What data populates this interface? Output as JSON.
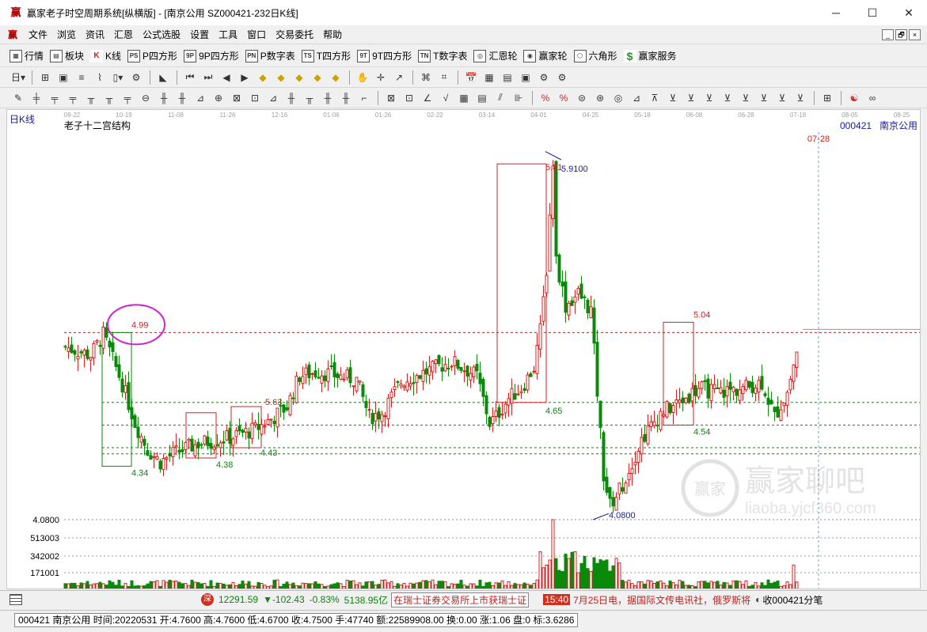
{
  "window": {
    "title": "赢家老子时空周期系统[纵横版] - [南京公用  SZ000421-232日K线]",
    "icon": "app-logo-icon",
    "minimize": "─",
    "maximize": "☐",
    "close": "✕"
  },
  "menu": {
    "items": [
      "文件",
      "浏览",
      "资讯",
      "汇恩",
      "公式选股",
      "设置",
      "工具",
      "窗口",
      "交易委托",
      "帮助"
    ],
    "mdi": [
      "_",
      "🗗",
      "×"
    ]
  },
  "toolbar1": {
    "items": [
      {
        "label": "行情",
        "icon": "table-icon",
        "glyph": "▦"
      },
      {
        "label": "板块",
        "icon": "sector-grid-icon",
        "glyph": "▤"
      },
      {
        "label": "K线",
        "icon": "candlestick-icon",
        "glyph": "K"
      },
      {
        "label": "P四方形",
        "icon": "ps-icon",
        "glyph": "PS"
      },
      {
        "label": "9P四方形",
        "icon": "9p-icon",
        "glyph": "9P"
      },
      {
        "label": "P数字表",
        "icon": "pn-icon",
        "glyph": "PN"
      },
      {
        "label": "T四方形",
        "icon": "ts-icon",
        "glyph": "TS"
      },
      {
        "label": "9T四方形",
        "icon": "9t-icon",
        "glyph": "9T"
      },
      {
        "label": "T数字表",
        "icon": "tn-icon",
        "glyph": "TN"
      },
      {
        "label": "汇恩轮",
        "icon": "wheel-icon",
        "glyph": "◎"
      },
      {
        "label": "赢家轮",
        "icon": "winner-wheel-icon",
        "glyph": "◉"
      },
      {
        "label": "六角形",
        "icon": "hexagon-icon",
        "glyph": "⬡"
      },
      {
        "label": "赢家服务",
        "icon": "dollar-icon",
        "glyph": "$"
      }
    ]
  },
  "toolbar2": {
    "buttons": [
      "日▾",
      "⊞",
      "▣",
      "≡",
      "⌇",
      "▯▾",
      "⚙",
      "◣",
      "⏮",
      "⏭",
      "◀",
      "▶",
      "◆",
      "◆",
      "◆",
      "◆",
      "◆",
      "✋",
      "✛",
      "↗",
      "⌘",
      "⌗",
      "📅",
      "▦",
      "▤",
      "▣",
      "⚙",
      "⚙"
    ]
  },
  "toolbar3": {
    "buttons": [
      "✎",
      "╪",
      "╤",
      "╤",
      "╥",
      "╥",
      "╤",
      "⊖",
      "╫",
      "╫",
      "⊿",
      "⊕",
      "⊠",
      "⊡",
      "⊿",
      "╫",
      "╥",
      "╫",
      "╫",
      "⌐",
      "⊠",
      "⊡",
      "∠",
      "√",
      "▦",
      "▤",
      "⫽",
      "⊪",
      "%",
      "%",
      "⊜",
      "⊛",
      "◎",
      "⊿",
      "⊼",
      "⊻",
      "⊻",
      "⊻",
      "⊻",
      "⊻",
      "⊻",
      "⊻",
      "⊻",
      "⊞",
      "☯",
      "∞"
    ]
  },
  "chart": {
    "period_label": "日K线",
    "indicator_title": "老子十二宫结构",
    "code": "000421",
    "name": "南京公用",
    "date_ticks": [
      "09-22",
      "10-19",
      "11-08",
      "11-26",
      "12-16",
      "01-06",
      "01-26",
      "02-22",
      "03-14",
      "04-01",
      "04-25",
      "05-18",
      "06-08",
      "06-28",
      "07-18",
      "08-05",
      "08-25"
    ],
    "cursor_date": "07-28",
    "price_labels": [
      {
        "text": "4.99",
        "color": "#d02020"
      },
      {
        "text": "4.34",
        "color": "#108010"
      },
      {
        "text": "4.38",
        "color": "#108010"
      },
      {
        "text": "4.43",
        "color": "#108010"
      },
      {
        "text": "5.63",
        "color": "#d02020"
      },
      {
        "text": "5.81",
        "color": "#d02020"
      },
      {
        "text": "5.9100",
        "color": "#1a1aa0"
      },
      {
        "text": "4.65",
        "color": "#108010"
      },
      {
        "text": "4.0800",
        "color": "#1a1aa0"
      },
      {
        "text": "5.04",
        "color": "#d02020"
      },
      {
        "text": "4.54",
        "color": "#108010"
      }
    ],
    "low_price_axis": "4.0800",
    "volume_axis": [
      "513003",
      "342002",
      "171001"
    ],
    "watermark_brand": "赢家聊吧",
    "watermark_url": "liaoba.yjcf360.com",
    "watermark_seal": "赢家"
  },
  "ticker": {
    "index_icon": "深",
    "index_value": "12291.59",
    "index_change": "▼-102.43",
    "index_pct": "-0.83%",
    "index_amount": "5138.95亿",
    "news1": "在瑞士证券交易所上市获瑞士证",
    "time": "15:40",
    "news2": "7月25日电，据国际文传电讯社，俄罗斯将",
    "stock_flow": "收000421分笔"
  },
  "status": {
    "text": "000421 南京公用 时间:20220531 开:4.7600 高:4.7600 低:4.6700 收:4.7500 手:47740 额:22589908.00 换:0.00 涨:1.06 盘:0 标:3.6286"
  },
  "colors": {
    "up": "#d42020",
    "down": "#0a8a0a",
    "blue": "#1a1aa0",
    "magenta": "#d020d0",
    "cursor": "#5aa8e0"
  }
}
